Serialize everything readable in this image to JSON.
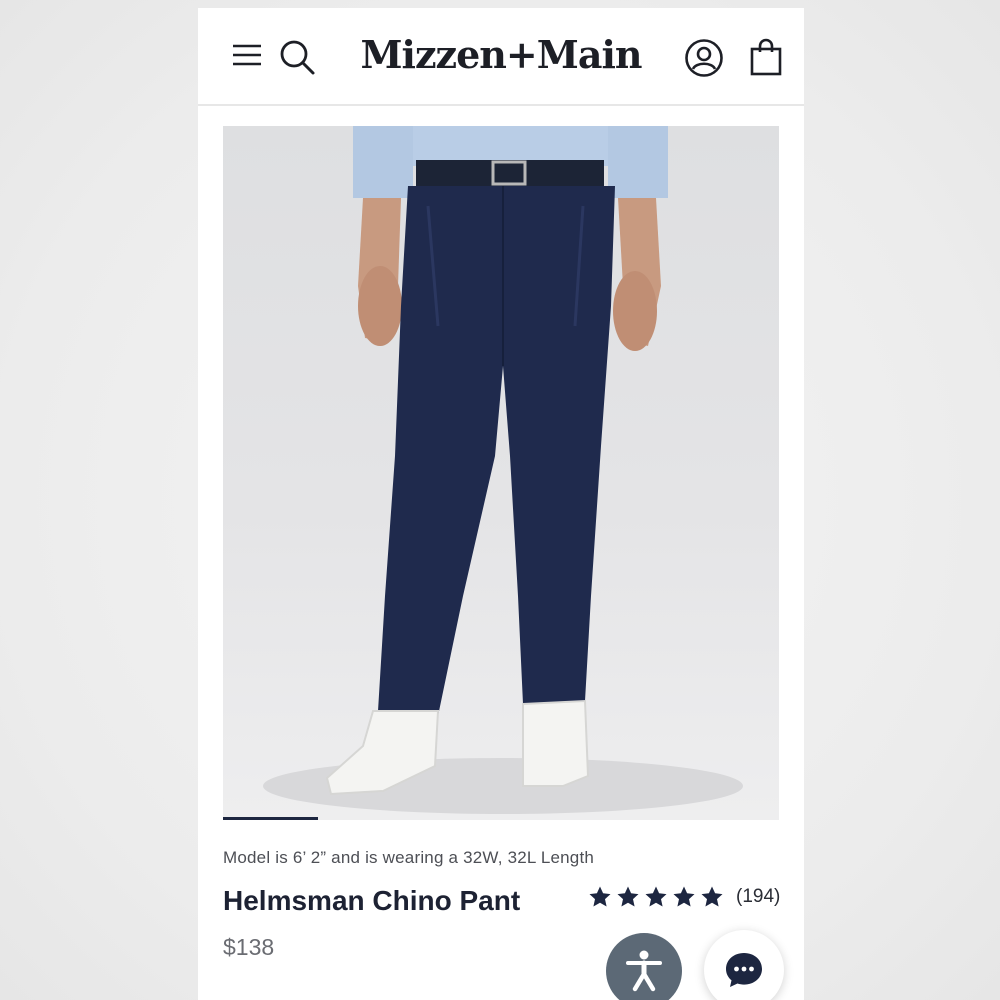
{
  "header": {
    "brand": "Mizzen+Main",
    "icons": [
      "menu-icon",
      "search-icon",
      "account-icon",
      "shopping-bag-icon"
    ]
  },
  "gallery": {
    "image": "product-photo-model-wearing-navy-pants",
    "progress": 0.17
  },
  "product": {
    "model_note": "Model is 6’ 2” and is wearing a 32W, 32L Length",
    "name": "Helmsman Chino Pant",
    "rating_stars": 5,
    "review_count": "(194)",
    "price": "$138"
  },
  "floating": {
    "accessibility_icon": "accessibility-icon",
    "chat_icon": "chat-icon"
  },
  "colors": {
    "navy": "#1d2640",
    "accessibility_bg": "#5c6976",
    "text_dark": "#1d2233",
    "price_gray": "#6a6c72"
  }
}
